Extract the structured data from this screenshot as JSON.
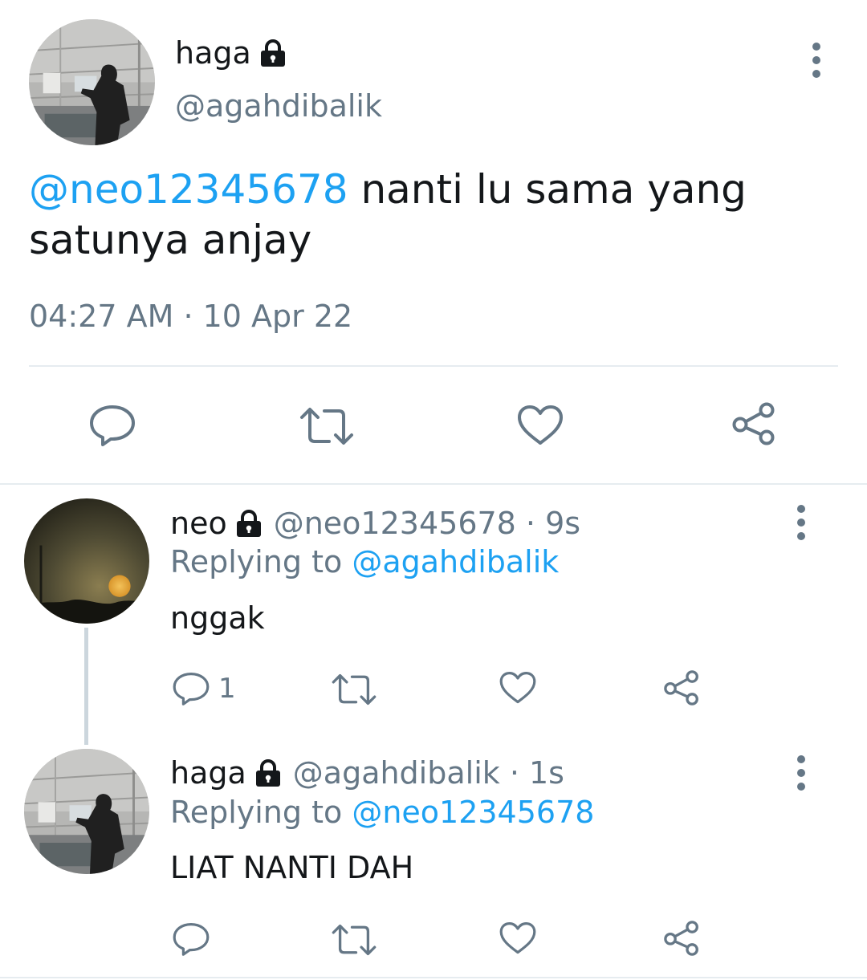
{
  "main_tweet": {
    "display_name": "haga",
    "handle": "@agahdibalik",
    "mention": "@neo12345678",
    "text": " nanti lu sama yang satunya anjay",
    "timestamp": "04:27 AM · 10 Apr 22"
  },
  "replies": [
    {
      "display_name": "neo",
      "handle": "@neo12345678 · 9s",
      "replying_prefix": "Replying to ",
      "replying_to": "@agahdibalik",
      "text": "nggak",
      "reply_count": "1"
    },
    {
      "display_name": "haga",
      "handle": "@agahdibalik · 1s",
      "replying_prefix": "Replying to ",
      "replying_to": "@neo12345678",
      "text": "LIAT NANTI DAH",
      "reply_count": ""
    }
  ],
  "colors": {
    "text": "#14171a",
    "secondary": "#657786",
    "link": "#1da1f2",
    "divider": "#e6ecf0",
    "icon": "#657786"
  },
  "icons": [
    "lock-icon",
    "more-icon",
    "reply-icon",
    "retweet-icon",
    "like-icon",
    "share-icon"
  ]
}
